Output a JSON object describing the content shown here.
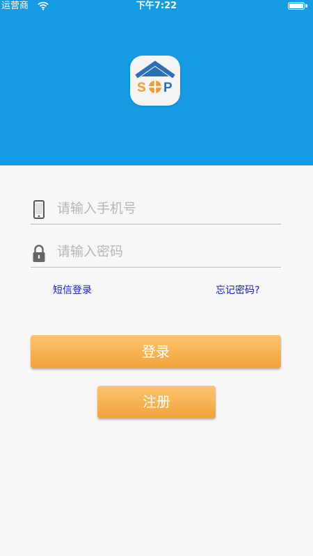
{
  "status_bar": {
    "carrier": "运营商",
    "time": "下午7:22",
    "battery_level": 1.0
  },
  "colors": {
    "header_bg": "#149be3",
    "button_orange": "#f3a33a",
    "link_blue": "#1a1ac8",
    "logo_orange": "#f29a2e"
  },
  "logo": {
    "icon": "sop-house-logo",
    "letters": [
      "S",
      "P"
    ]
  },
  "form": {
    "phone_placeholder": "请输入手机号",
    "password_placeholder": "请输入密码",
    "phone_icon": "phone-icon",
    "lock_icon": "lock-icon"
  },
  "links": {
    "sms_login": "短信登录",
    "forgot_password": "忘记密码?"
  },
  "buttons": {
    "login": "登录",
    "register": "注册"
  }
}
